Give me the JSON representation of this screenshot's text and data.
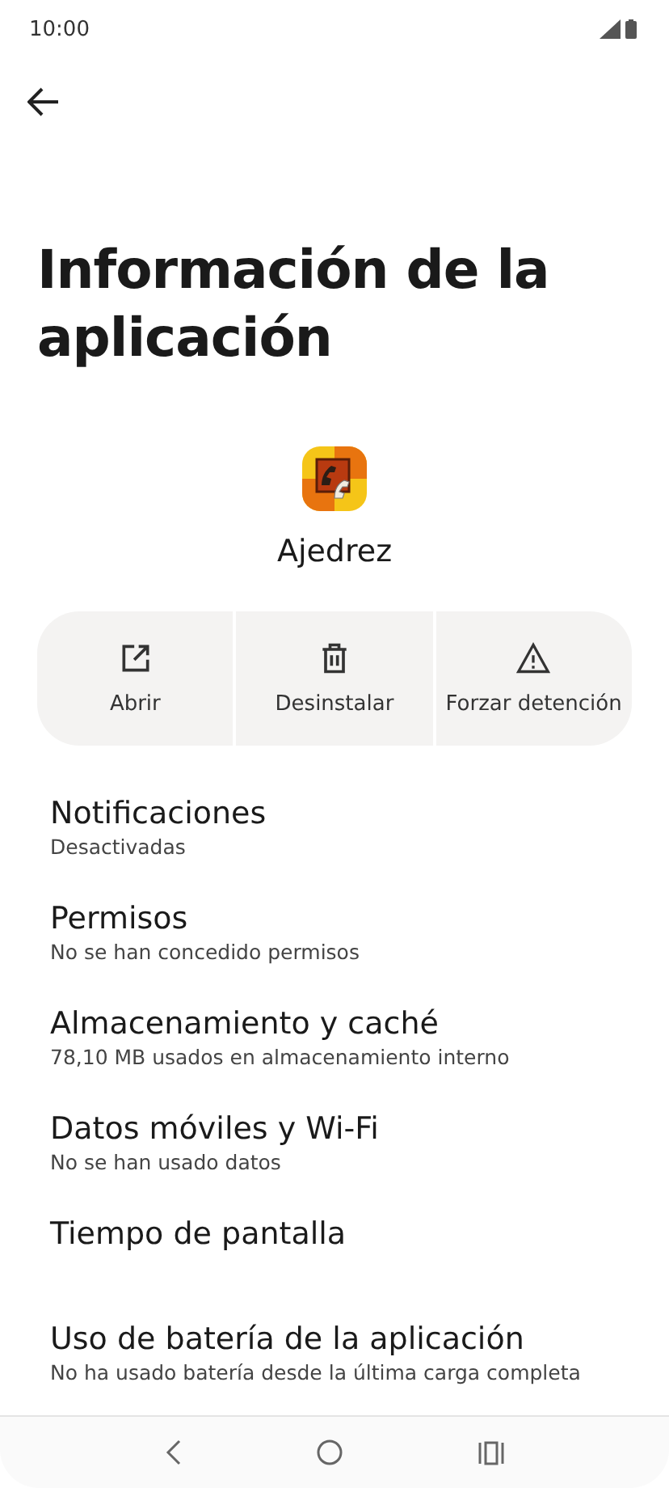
{
  "status_bar": {
    "time": "10:00"
  },
  "title": "Información de la aplicación",
  "app": {
    "name": "Ajedrez"
  },
  "actions": [
    {
      "kind": "open",
      "label": "Abrir"
    },
    {
      "kind": "trash",
      "label": "Desinstalar"
    },
    {
      "kind": "warning",
      "label": "Forzar detención"
    }
  ],
  "settings": [
    {
      "title": "Notificaciones",
      "subtitle": "Desactivadas"
    },
    {
      "title": "Permisos",
      "subtitle": "No se han concedido permisos"
    },
    {
      "title": "Almacenamiento y caché",
      "subtitle": "78,10 MB usados en almacenamiento interno"
    },
    {
      "title": "Datos móviles y Wi-Fi",
      "subtitle": "No se han usado datos"
    },
    {
      "title": "Tiempo de pantalla"
    },
    {
      "title": "Uso de batería de la aplicación",
      "subtitle": "No ha usado batería desde la última carga completa"
    }
  ]
}
